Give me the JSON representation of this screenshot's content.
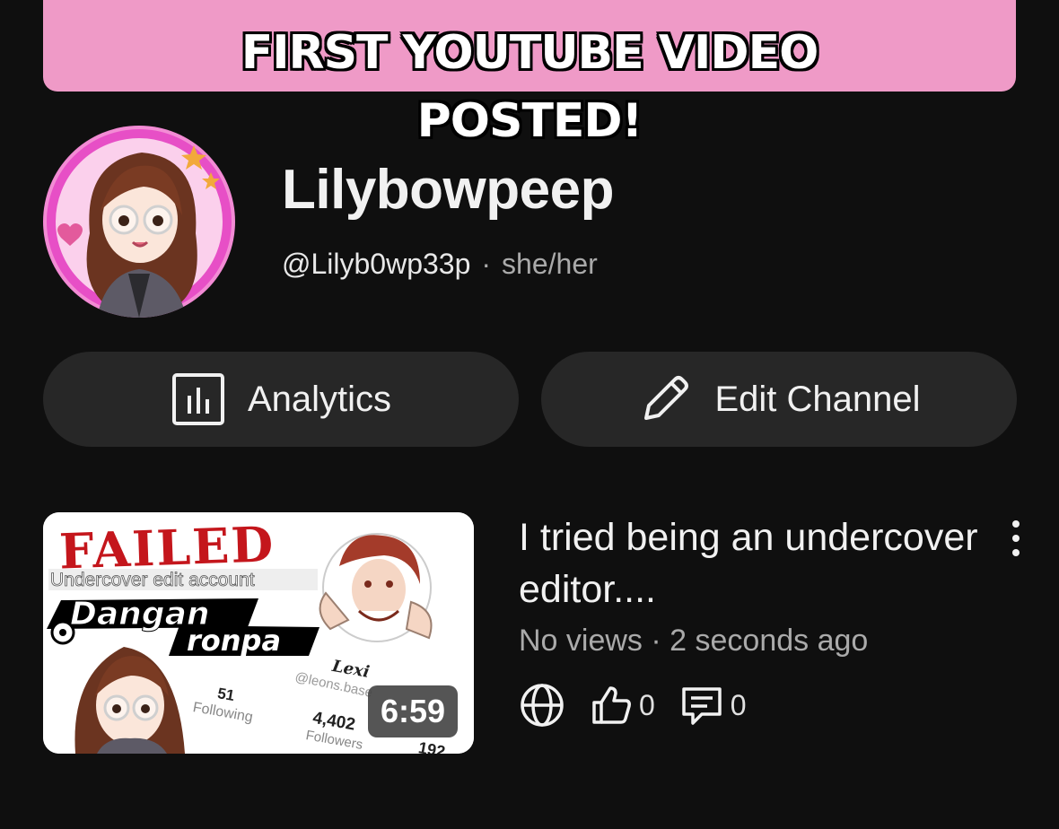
{
  "overlay": {
    "caption_line1": "FIRST YOUTUBE VIDEO",
    "caption_line2": "POSTED!",
    "banner_color": "#ef9ac7"
  },
  "channel": {
    "name": "Lilybowpeep",
    "handle": "@Lilyb0wp33p",
    "separator": "·",
    "pronouns": "she/her",
    "avatar_icon": "profile-avatar"
  },
  "actions": {
    "analytics_label": "Analytics",
    "analytics_icon": "analytics-chart-icon",
    "edit_label": "Edit Channel",
    "edit_icon": "pencil-icon"
  },
  "video": {
    "title": "I tried being an undercover editor....",
    "meta": "No views · 2 seconds ago",
    "duration": "6:59",
    "visibility_icon": "globe-icon",
    "likes": "0",
    "comments": "0",
    "thumbnail": {
      "headline": "FAILED",
      "subline": "Undercover edit account",
      "logo_line1": "Dangan",
      "logo_line2": "ronpa",
      "profile_name": "Lexi",
      "profile_handle": "@leons.base",
      "following_count": "51",
      "following_label": "Following",
      "followers_count": "4,402",
      "followers_label": "Followers",
      "extra_count": "192"
    }
  },
  "colors": {
    "background": "#0f0f0f",
    "button_bg": "#272727",
    "secondary_text": "#aaaaaa"
  }
}
